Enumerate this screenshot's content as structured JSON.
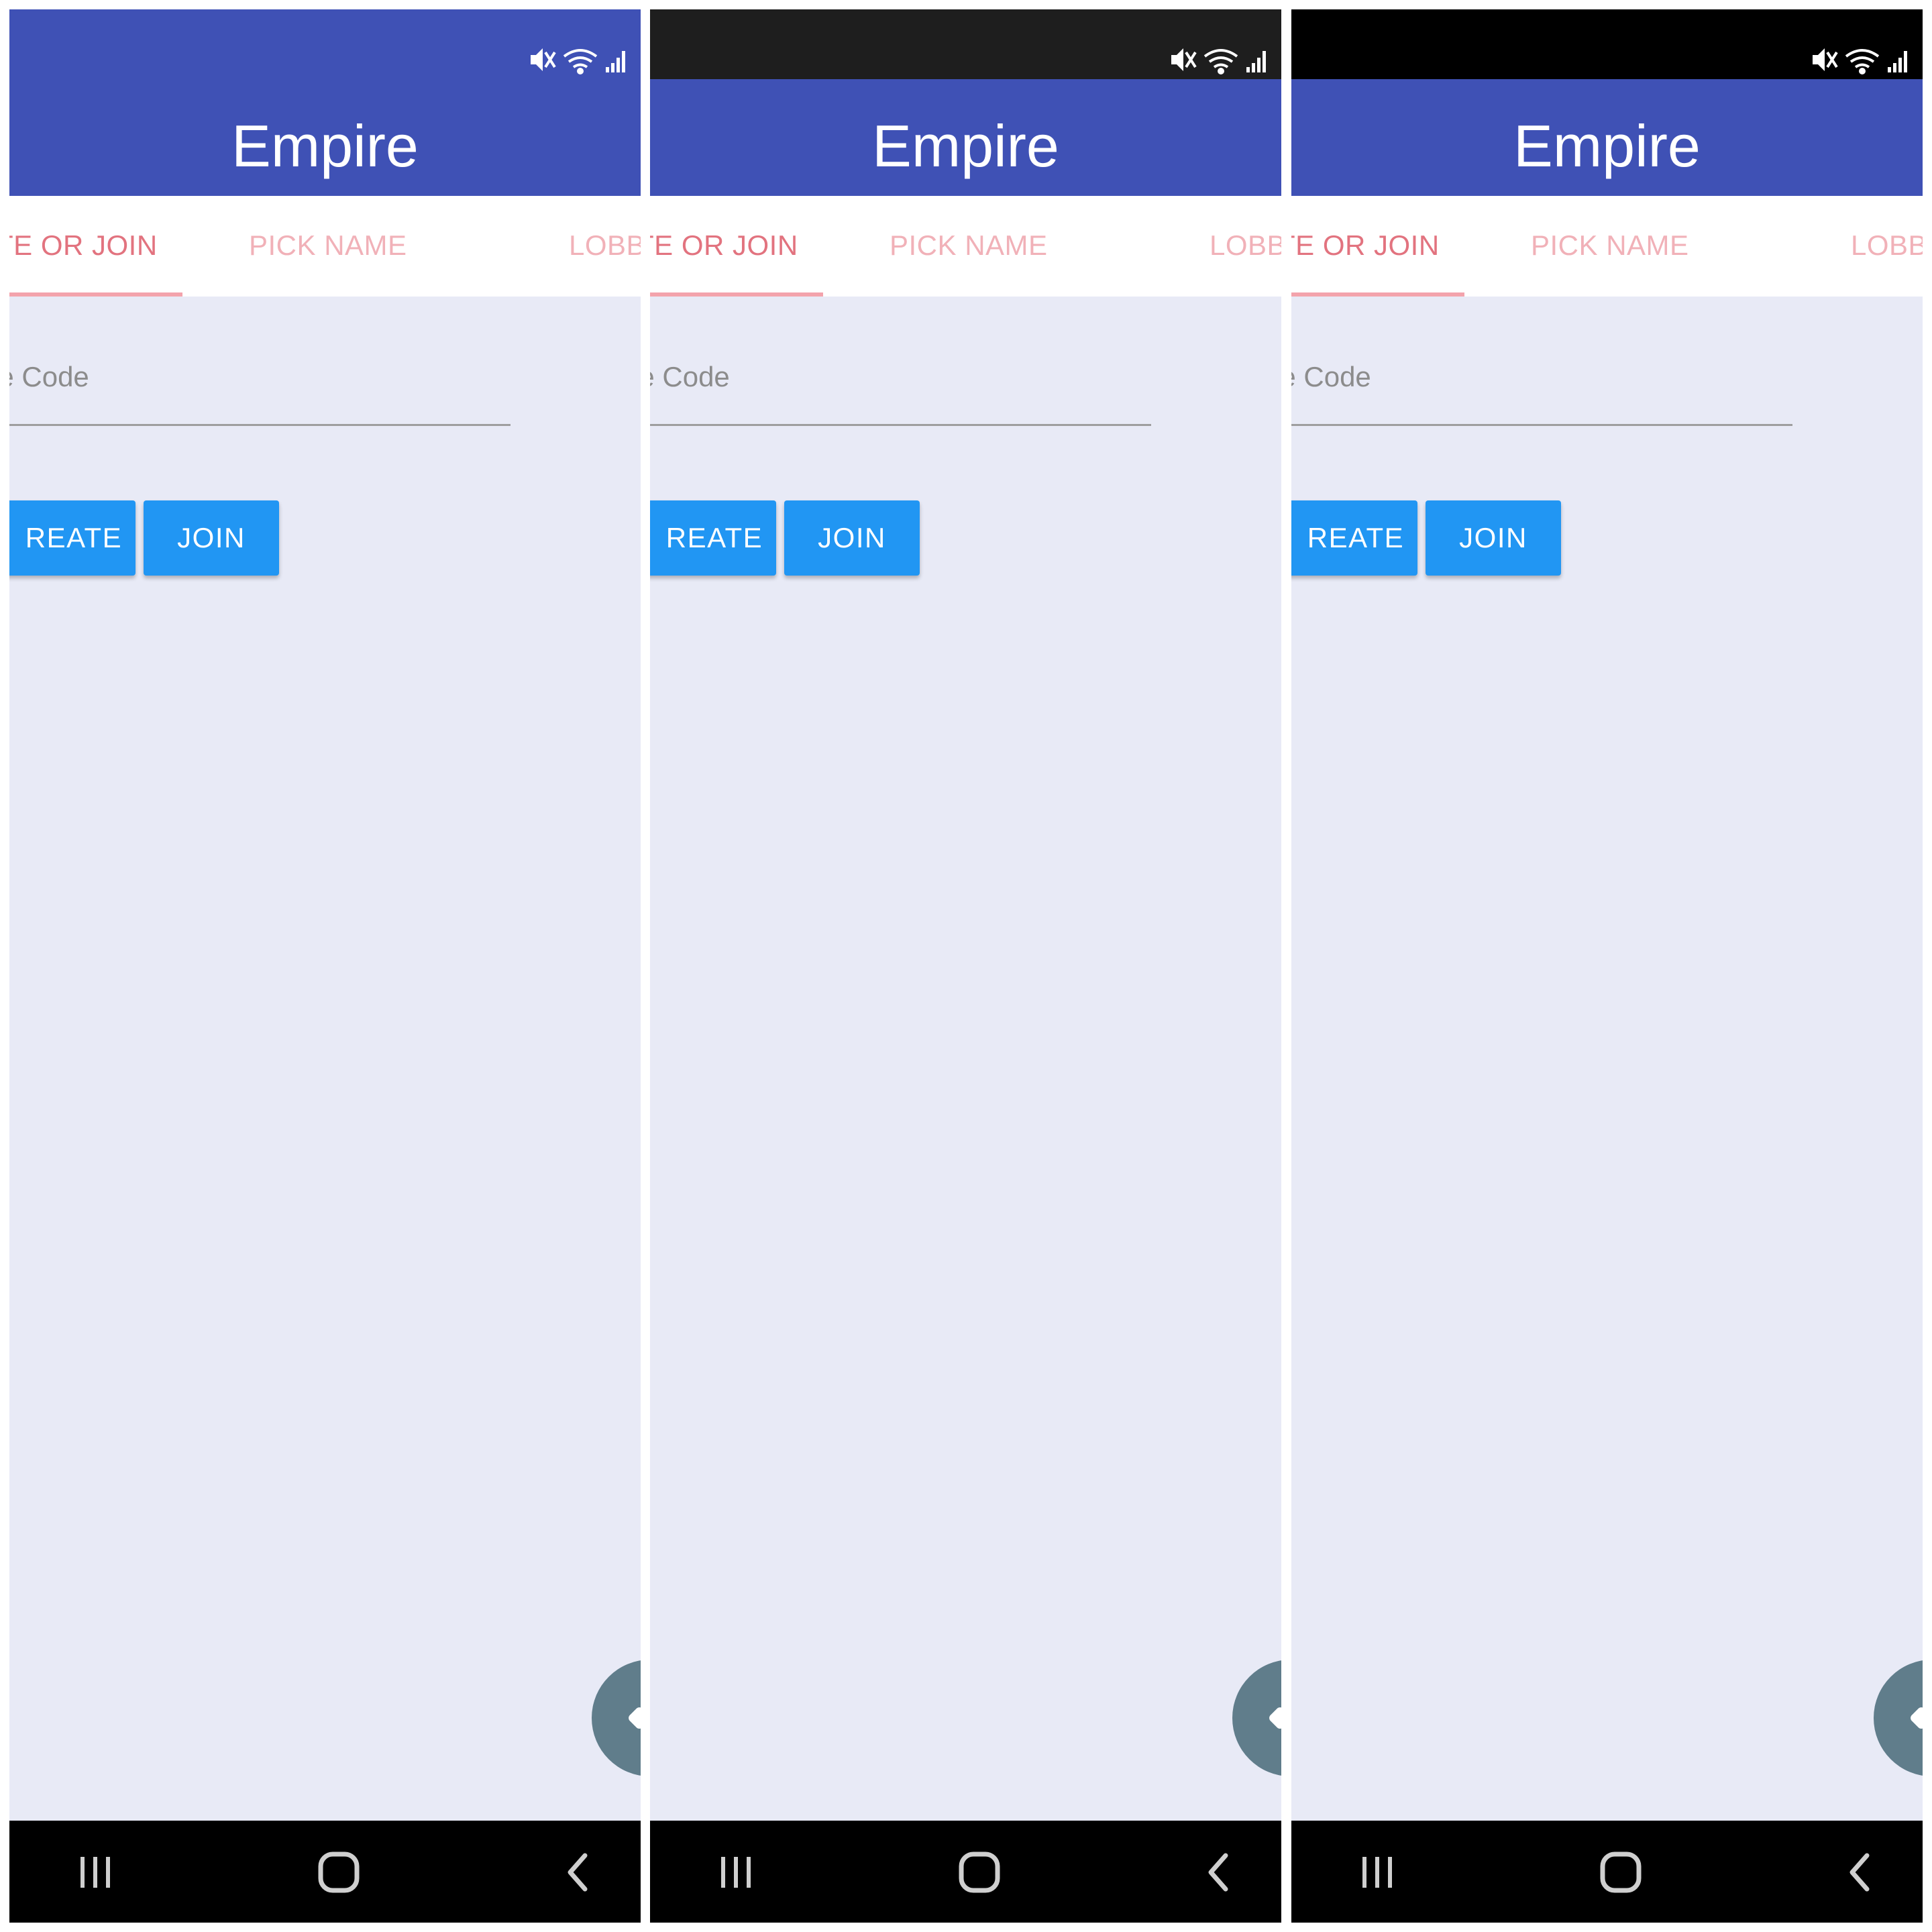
{
  "colors": {
    "app_bar": "#3f51b5",
    "content_background": "#e8eaf6",
    "tab_active_text": "#e2737f",
    "tab_inactive_text": "#f1b1b8",
    "tab_indicator": "#f3a3ac",
    "button": "#2196f3",
    "fab": "#607d8b",
    "nav_bar": "#000000"
  },
  "screens": [
    {
      "status_bar_color": "#3f51b5",
      "icons": [
        "mute-icon",
        "wifi-icon",
        "signal-icon"
      ],
      "app_title": "Empire",
      "tabs": [
        {
          "label": "TE OR JOIN",
          "selected": true
        },
        {
          "label": "PICK NAME",
          "selected": false
        },
        {
          "label": "LOBB",
          "selected": false
        }
      ],
      "code_field": {
        "placeholder": "ne Code",
        "value": ""
      },
      "buttons": {
        "create": "REATE",
        "join": "JOIN"
      },
      "nav": [
        "recents-icon",
        "home-icon",
        "back-icon"
      ]
    },
    {
      "status_bar_color": "#1e1e1e",
      "icons": [
        "mute-icon",
        "wifi-icon",
        "signal-icon"
      ],
      "app_title": "Empire",
      "tabs": [
        {
          "label": "TE OR JOIN",
          "selected": true
        },
        {
          "label": "PICK NAME",
          "selected": false
        },
        {
          "label": "LOBB",
          "selected": false
        }
      ],
      "code_field": {
        "placeholder": "ne Code",
        "value": ""
      },
      "buttons": {
        "create": "REATE",
        "join": "JOIN"
      },
      "nav": [
        "recents-icon",
        "home-icon",
        "back-icon"
      ]
    },
    {
      "status_bar_color": "#000000",
      "icons": [
        "mute-icon",
        "wifi-icon",
        "signal-icon"
      ],
      "app_title": "Empire",
      "tabs": [
        {
          "label": "TE OR JOIN",
          "selected": true
        },
        {
          "label": "PICK NAME",
          "selected": false
        },
        {
          "label": "LOBB",
          "selected": false
        }
      ],
      "code_field": {
        "placeholder": "ne Code",
        "value": ""
      },
      "buttons": {
        "create": "REATE",
        "join": "JOIN"
      },
      "nav": [
        "recents-icon",
        "home-icon",
        "back-icon"
      ]
    }
  ]
}
